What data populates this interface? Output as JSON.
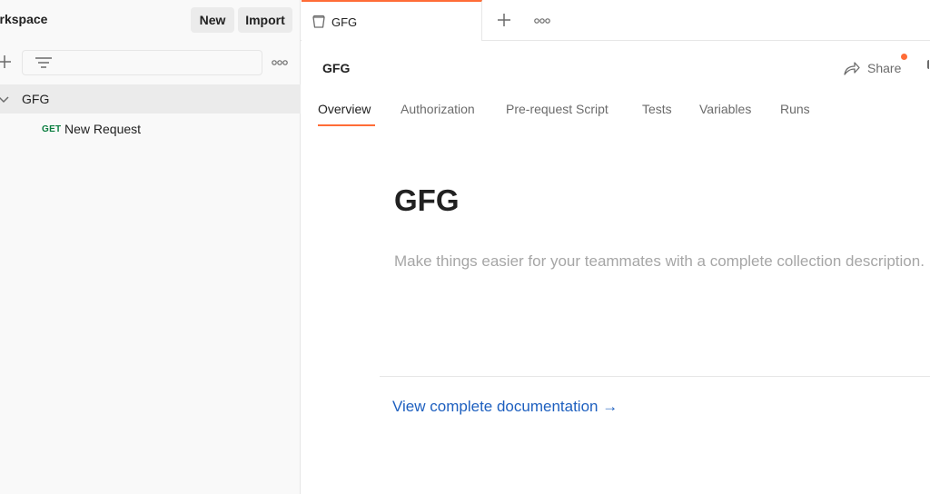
{
  "sidebar": {
    "workspace_title": "Workspace",
    "new_label": "New",
    "import_label": "Import",
    "collection": {
      "name": "GFG",
      "requests": [
        {
          "method": "GET",
          "name": "New Request"
        }
      ]
    }
  },
  "tabs": {
    "active_tab_label": "GFG"
  },
  "header": {
    "collection_name": "GFG",
    "share_label": "Share"
  },
  "subtabs": [
    {
      "label": "Overview",
      "active": true
    },
    {
      "label": "Authorization",
      "active": false
    },
    {
      "label": "Pre-request Script",
      "active": false
    },
    {
      "label": "Tests",
      "active": false
    },
    {
      "label": "Variables",
      "active": false
    },
    {
      "label": "Runs",
      "active": false
    }
  ],
  "overview": {
    "title": "GFG",
    "description_placeholder": "Make things easier for your teammates with a complete collection description.",
    "docs_link": "View complete documentation →"
  },
  "colors": {
    "accent": "#ff6c37",
    "link": "#1d5fbf",
    "get_method": "#0a7d3f"
  },
  "icons": [
    "plus-icon",
    "filter-icon",
    "more-icon",
    "chevron-down-icon",
    "collection-icon",
    "share-icon"
  ]
}
